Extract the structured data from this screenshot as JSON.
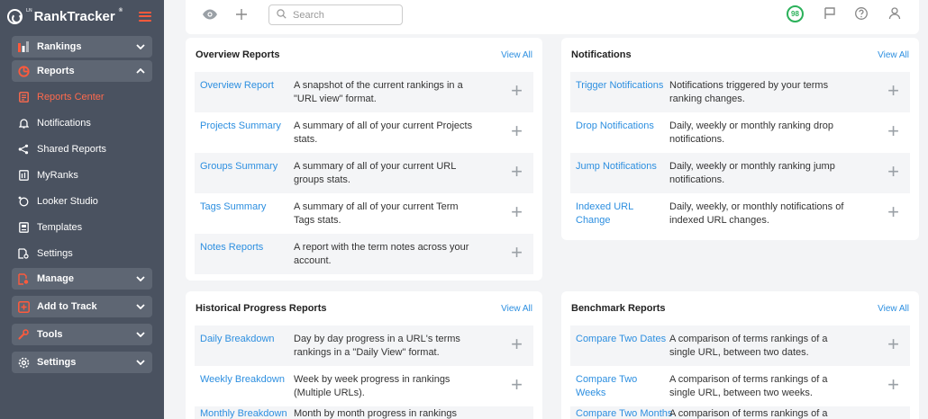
{
  "app": {
    "logo_prefix": "LN",
    "logo_text": "RankTracker",
    "logo_trademark": "®"
  },
  "sidebar": {
    "groups": [
      {
        "label": "Rankings",
        "expanded": false
      },
      {
        "label": "Reports",
        "expanded": true,
        "items": [
          {
            "label": "Reports Center",
            "active": true
          },
          {
            "label": "Notifications"
          },
          {
            "label": "Shared Reports"
          },
          {
            "label": "MyRanks"
          },
          {
            "label": "Looker Studio"
          },
          {
            "label": "Templates"
          },
          {
            "label": "Settings"
          }
        ]
      },
      {
        "label": "Manage",
        "expanded": false
      },
      {
        "label": "Add to Track",
        "expanded": false
      },
      {
        "label": "Tools",
        "expanded": false
      },
      {
        "label": "Settings",
        "expanded": false
      }
    ]
  },
  "topbar": {
    "search_placeholder": "Search",
    "score": "98"
  },
  "colors": {
    "accent": "#ff6a4d",
    "link": "#2d8fe0",
    "sidebar": "#4a5260",
    "score_green": "#2bb15a"
  },
  "cards": {
    "overview": {
      "title": "Overview Reports",
      "view_all": "View All",
      "rows": [
        {
          "link": "Overview Report",
          "desc": "A snapshot of the current rankings in a \"URL view\" format."
        },
        {
          "link": "Projects Summary",
          "desc": "A summary of all of your current Projects stats."
        },
        {
          "link": "Groups Summary",
          "desc": "A summary of all of your current URL groups stats."
        },
        {
          "link": "Tags Summary",
          "desc": "A summary of all of your current Term Tags stats."
        },
        {
          "link": "Notes Reports",
          "desc": "A report with the term notes across your account."
        }
      ]
    },
    "notifications": {
      "title": "Notifications",
      "view_all": "View All",
      "rows": [
        {
          "link": "Trigger Notifications",
          "desc": "Notifications triggered by your terms ranking changes."
        },
        {
          "link": "Drop Notifications",
          "desc": "Daily, weekly or monthly ranking drop notifications."
        },
        {
          "link": "Jump Notifications",
          "desc": "Daily, weekly or monthly ranking jump notifications."
        },
        {
          "link": "Indexed URL Change",
          "desc": "Daily, weekly, or monthly notifications of indexed URL changes."
        }
      ]
    },
    "historical": {
      "title": "Historical Progress Reports",
      "view_all": "View All",
      "rows": [
        {
          "link": "Daily Breakdown",
          "desc": "Day by day progress in a URL's terms rankings in a \"Daily View\" format."
        },
        {
          "link": "Weekly Breakdown",
          "desc": "Week by week progress in rankings (Multiple URLs)."
        },
        {
          "link": "Monthly Breakdown",
          "desc": "Month by month progress in rankings"
        }
      ]
    },
    "benchmark": {
      "title": "Benchmark Reports",
      "view_all": "View All",
      "rows": [
        {
          "link": "Compare Two Dates",
          "desc": "A comparison of terms rankings of a single URL, between two dates."
        },
        {
          "link": "Compare Two Weeks",
          "desc": "A comparison of terms rankings of a single URL, between two weeks."
        },
        {
          "link": "Compare Two Months",
          "desc": "A comparison of terms rankings of a"
        }
      ]
    }
  }
}
